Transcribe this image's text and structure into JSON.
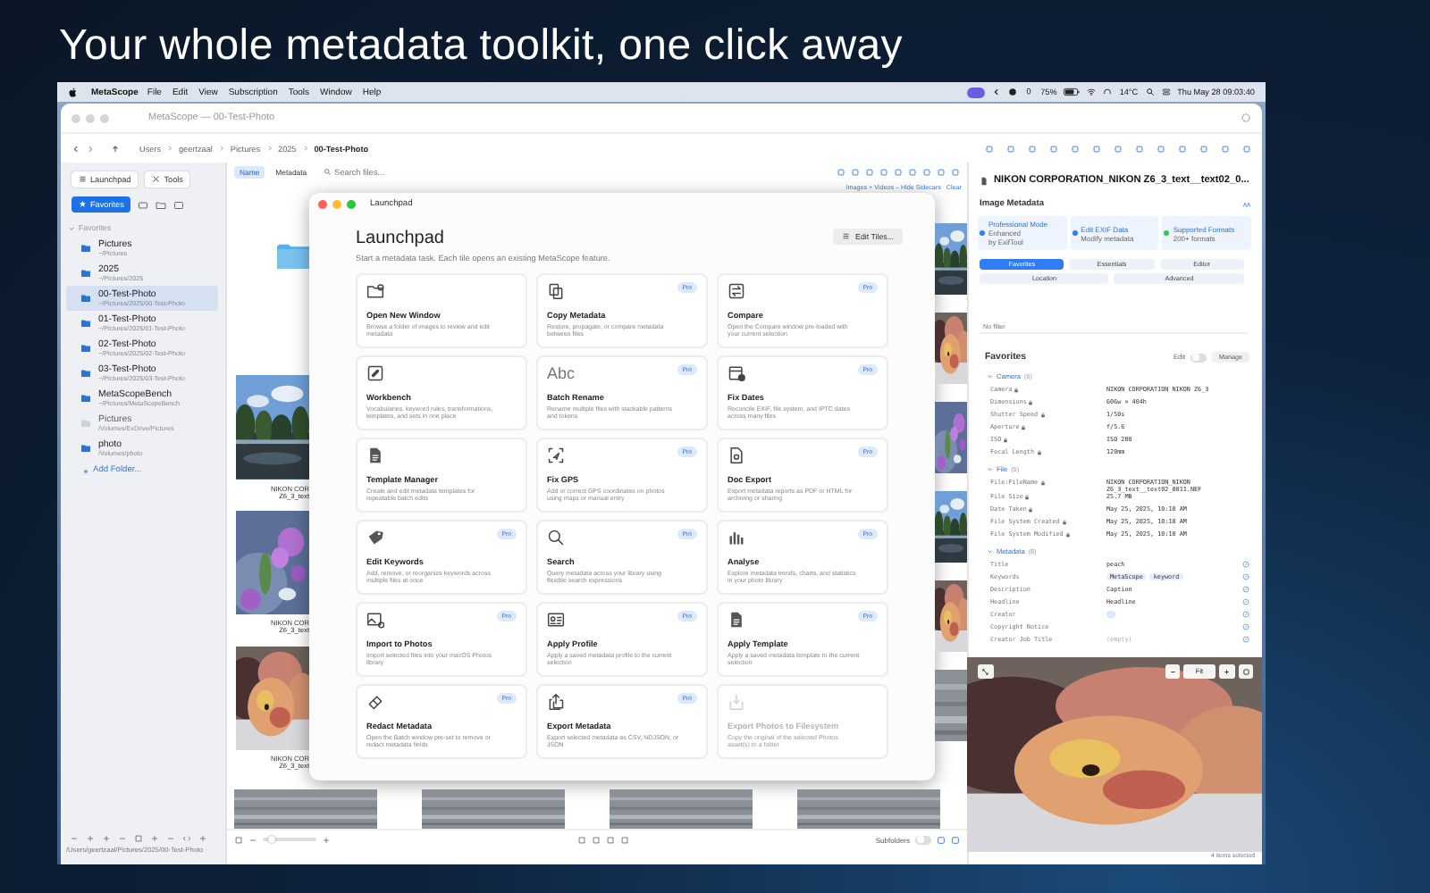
{
  "headline": "Your whole metadata toolkit, one click away",
  "menu_bar": {
    "app": "MetaScope",
    "items": [
      "File",
      "Edit",
      "View",
      "Subscription",
      "Tools",
      "Window",
      "Help"
    ],
    "battery": "75%",
    "temperature": "14°C",
    "clock": "Thu May 28  09:03:40"
  },
  "window": {
    "title": "MetaScope — 00-Test-Photo"
  },
  "path_bar": {
    "crumbs": [
      "Users",
      "geertzaal",
      "Pictures",
      "2025",
      "00-Test-Photo"
    ]
  },
  "sidebar": {
    "buttons": [
      "Launchpad",
      "Tools"
    ],
    "favorites_tab": {
      "label": "Favorites",
      "selected": true
    },
    "section": "Favorites",
    "items": [
      {
        "name": "Pictures",
        "path": "~/Pictures",
        "selected": false,
        "disabled": false
      },
      {
        "name": "2025",
        "path": "~/Pictures/2025",
        "selected": false,
        "disabled": false
      },
      {
        "name": "00-Test-Photo",
        "path": "~/Pictures/2025/00-Test-Photo",
        "selected": true,
        "disabled": false
      },
      {
        "name": "01-Test-Photo",
        "path": "~/Pictures/2025/01-Test-Photo",
        "selected": false,
        "disabled": false
      },
      {
        "name": "02-Test-Photo",
        "path": "~/Pictures/2025/02-Test-Photo",
        "selected": false,
        "disabled": false
      },
      {
        "name": "03-Test-Photo",
        "path": "~/Pictures/2025/03-Test-Photo",
        "selected": false,
        "disabled": false
      },
      {
        "name": "MetaScopeBench",
        "path": "~/Pictures/MetaScopeBench",
        "selected": false,
        "disabled": false
      },
      {
        "name": "Pictures",
        "path": "/Volumes/ExDrive/Pictures",
        "selected": false,
        "disabled": true
      },
      {
        "name": "photo",
        "path": "/Volumes/photo",
        "selected": false,
        "disabled": false
      }
    ],
    "add_folder": "Add Folder...",
    "footer_path": "/Users/geertzaal/Pictures/2025/00-Test-Photo"
  },
  "browser": {
    "tabs": [
      {
        "label": "Name",
        "selected": true
      },
      {
        "label": "Metadata",
        "selected": false
      }
    ],
    "search": {
      "placeholder": "Search files..."
    },
    "filter": "Images + Videos – Hide Sidecars",
    "clear": "Clear",
    "captions": [
      [
        "NIKON COR",
        "Z6_3_text"
      ],
      [
        "NIKON COR",
        "Z6_3_text"
      ],
      [
        "NIKON COR",
        "Z6_3_text"
      ]
    ],
    "thumbnail_size": {
      "level": 0.1
    },
    "subfolders": "Subfolders",
    "subfolders_on": false
  },
  "launchpad": {
    "window_title": "Launchpad",
    "heading": "Launchpad",
    "subtitle": "Start a metadata task. Each tile opens an existing MetaScope feature.",
    "edit_button": "Edit Tiles...",
    "tiles": [
      {
        "title": "Open New Window",
        "description": "Browse a folder of images to review and edit metadata",
        "disabled": false
      },
      {
        "title": "Copy Metadata",
        "description": "Restore, propagate, or compare metadata between files",
        "badge": "Pro",
        "disabled": false
      },
      {
        "title": "Compare",
        "description": "Open the Compare window pre-loaded with your current selection",
        "badge": "Pro",
        "disabled": false
      },
      {
        "title": "Workbench",
        "description": "Vocabularies, keyword rules, transformations, templates, and sets in one place",
        "disabled": false
      },
      {
        "title": "Batch Rename",
        "icon_text": "Abc",
        "description": "Rename multiple files with stackable patterns and tokens",
        "badge": "Pro",
        "disabled": false
      },
      {
        "title": "Fix Dates",
        "description": "Reconcile EXIF, file system, and IPTC dates across many files",
        "badge": "Pro",
        "disabled": false
      },
      {
        "title": "Template Manager",
        "description": "Create and edit metadata templates for repeatable batch edits",
        "disabled": false
      },
      {
        "title": "Fix GPS",
        "description": "Add or correct GPS coordinates on photos using maps or manual entry",
        "badge": "Pro",
        "disabled": false
      },
      {
        "title": "Doc Export",
        "description": "Export metadata reports as PDF or HTML for archiving or sharing",
        "badge": "Pro",
        "disabled": false
      },
      {
        "title": "Edit Keywords",
        "description": "Add, remove, or reorganize keywords across multiple files at once",
        "badge": "Pro",
        "disabled": false
      },
      {
        "title": "Search",
        "description": "Query metadata across your library using flexible search expressions",
        "badge": "Pro",
        "disabled": false
      },
      {
        "title": "Analyse",
        "description": "Explore metadata trends, charts, and statistics in your photo library",
        "badge": "Pro",
        "disabled": false
      },
      {
        "title": "Import to Photos",
        "description": "Import selected files into your macOS Photos library",
        "badge": "Pro",
        "disabled": false
      },
      {
        "title": "Apply Profile",
        "description": "Apply a saved metadata profile to the current selection",
        "badge": "Pro",
        "disabled": false
      },
      {
        "title": "Apply Template",
        "description": "Apply a saved metadata template to the current selection",
        "badge": "Pro",
        "disabled": false
      },
      {
        "title": "Redact Metadata",
        "description": "Open the Batch window pre-set to remove or redact metadata fields",
        "badge": "Pro",
        "disabled": false
      },
      {
        "title": "Export Metadata",
        "description": "Export selected metadata as CSV, NDJSON, or JSON",
        "badge": "Pro",
        "disabled": false
      },
      {
        "title": "Export Photos to Filesystem",
        "description": "Copy the original of the selected Photos asset(s) to a folder",
        "disabled": true
      }
    ]
  },
  "inspector": {
    "file_title": "NIKON CORPORATION_NIKON Z6_3_text__text02_0...",
    "heading": "Image Metadata",
    "cards": [
      {
        "title": "Professional Mode",
        "lines": [
          "Enhanced",
          "by ExifTool"
        ],
        "color": "#2f7cf6"
      },
      {
        "title": "Edit EXIF Data",
        "lines": [
          "Modify metadata"
        ],
        "color": "#2f7cf6"
      },
      {
        "title": "Supported Formats",
        "lines": [
          "200+ formats"
        ],
        "color": "#34c759"
      }
    ],
    "tabs": [
      {
        "label": "Favorites",
        "selected": true
      },
      {
        "label": "Essentials",
        "selected": false
      },
      {
        "label": "Editor",
        "selected": false
      },
      {
        "label": "Location",
        "selected": false
      },
      {
        "label": "Advanced",
        "selected": false
      }
    ],
    "filter": {
      "placeholder": "No filter"
    },
    "favorites": {
      "title": "Favorites",
      "edit": "Edit",
      "edit_on": false,
      "manage": "Manage"
    },
    "groups": [
      {
        "title": "Camera",
        "count": "(6)",
        "expanded": true,
        "rows": [
          {
            "kind": "text",
            "label": "Camera",
            "locked": true,
            "editable": false,
            "value": "NIKON CORPORATION NIKON Z6_3"
          },
          {
            "kind": "text",
            "label": "Dimensions",
            "locked": true,
            "editable": false,
            "value": "606w × 404h"
          },
          {
            "kind": "text",
            "label": "Shutter Speed",
            "locked": true,
            "editable": false,
            "value": "1/50s"
          },
          {
            "kind": "text",
            "label": "Aperture",
            "locked": true,
            "editable": false,
            "value": "f/5.6"
          },
          {
            "kind": "text",
            "label": "ISO",
            "locked": true,
            "editable": false,
            "value": "ISO 200"
          },
          {
            "kind": "text",
            "label": "Focal Length",
            "locked": true,
            "editable": false,
            "value": "120mm"
          }
        ]
      },
      {
        "title": "File",
        "count": "(5)",
        "expanded": true,
        "rows": [
          {
            "kind": "text",
            "label": "File:FileName",
            "locked": true,
            "editable": false,
            "value": "NIKON CORPORATION_NIKON Z6_3_text__text02_0011.NEF"
          },
          {
            "kind": "text",
            "label": "File Size",
            "locked": true,
            "editable": false,
            "value": "25.7 MB"
          },
          {
            "kind": "text",
            "label": "Date Taken",
            "locked": true,
            "editable": false,
            "value": "May 25, 2025, 10:10 AM"
          },
          {
            "kind": "text",
            "label": "File System Created",
            "locked": true,
            "editable": false,
            "value": "May 25, 2025, 10:10 AM"
          },
          {
            "kind": "text",
            "label": "File System Modified",
            "locked": true,
            "editable": false,
            "value": "May 25, 2025, 10:10 AM"
          }
        ]
      },
      {
        "title": "Metadata",
        "count": "(8)",
        "expanded": true,
        "rows": [
          {
            "kind": "text",
            "label": "Title",
            "locked": false,
            "editable": true,
            "value": "peach"
          },
          {
            "kind": "tags",
            "label": "Keywords",
            "locked": false,
            "editable": true,
            "tags": [
              "MetaScope",
              "keyword"
            ]
          },
          {
            "kind": "text",
            "label": "Description",
            "locked": false,
            "editable": true,
            "value": "Caption"
          },
          {
            "kind": "text",
            "label": "Headline",
            "locked": false,
            "editable": true,
            "value": "Headline"
          },
          {
            "kind": "blank",
            "label": "Creator",
            "locked": false,
            "editable": true
          },
          {
            "kind": "text",
            "label": "Copyright Notice",
            "locked": false,
            "editable": true
          },
          {
            "kind": "empty",
            "label": "Creator Job Title",
            "locked": false,
            "editable": true,
            "placeholder": "(empty)"
          }
        ]
      }
    ]
  },
  "preview": {
    "zoom": "Fit",
    "status": "4 items selected"
  }
}
